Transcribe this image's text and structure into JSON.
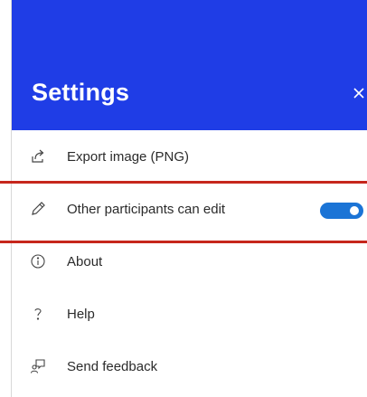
{
  "settings_panel": {
    "title": "Settings",
    "close_glyph": "×",
    "header_color": "#1f3de6",
    "accent_color": "#1b74d6",
    "highlight_color": "#c6261c",
    "items": [
      {
        "label": "Export image (PNG)",
        "icon": "export-icon"
      },
      {
        "label": "Other participants can edit",
        "icon": "pencil-icon",
        "toggle": {
          "on": true
        }
      },
      {
        "label": "About",
        "icon": "info-icon"
      },
      {
        "label": "Help",
        "icon": "question-icon"
      },
      {
        "label": "Send feedback",
        "icon": "feedback-icon"
      }
    ]
  }
}
